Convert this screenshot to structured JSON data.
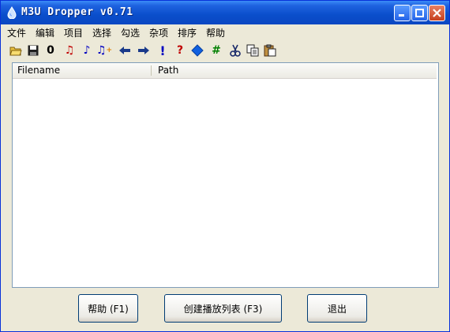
{
  "window": {
    "title": "M3U Dropper v0.71"
  },
  "menu": [
    {
      "label": "文件"
    },
    {
      "label": "编辑"
    },
    {
      "label": "项目"
    },
    {
      "label": "选择"
    },
    {
      "label": "勾选"
    },
    {
      "label": "杂项"
    },
    {
      "label": "排序"
    },
    {
      "label": "帮助"
    }
  ],
  "toolbar": {
    "icons": [
      "open-folder-icon",
      "save-icon",
      "zero-icon",
      "music-note-red-icon",
      "music-note-blue-icon",
      "add-music-icon",
      "arrow-left-icon",
      "arrow-right-icon",
      "exclamation-icon",
      "question-icon",
      "diamond-icon",
      "hash-icon",
      "cut-icon",
      "copy-icon",
      "paste-icon"
    ],
    "zero": "0",
    "exclaim": "!",
    "question": "?",
    "hash": "#",
    "colors": {
      "red": "#c00000",
      "blue": "#0000c0",
      "green": "#008000",
      "diamond": "#1060e0"
    }
  },
  "list": {
    "columns": [
      {
        "label": "Filename"
      },
      {
        "label": "Path"
      }
    ]
  },
  "buttons": {
    "help": "帮助 (F1)",
    "create": "创建播放列表 (F3)",
    "exit": "退出"
  }
}
